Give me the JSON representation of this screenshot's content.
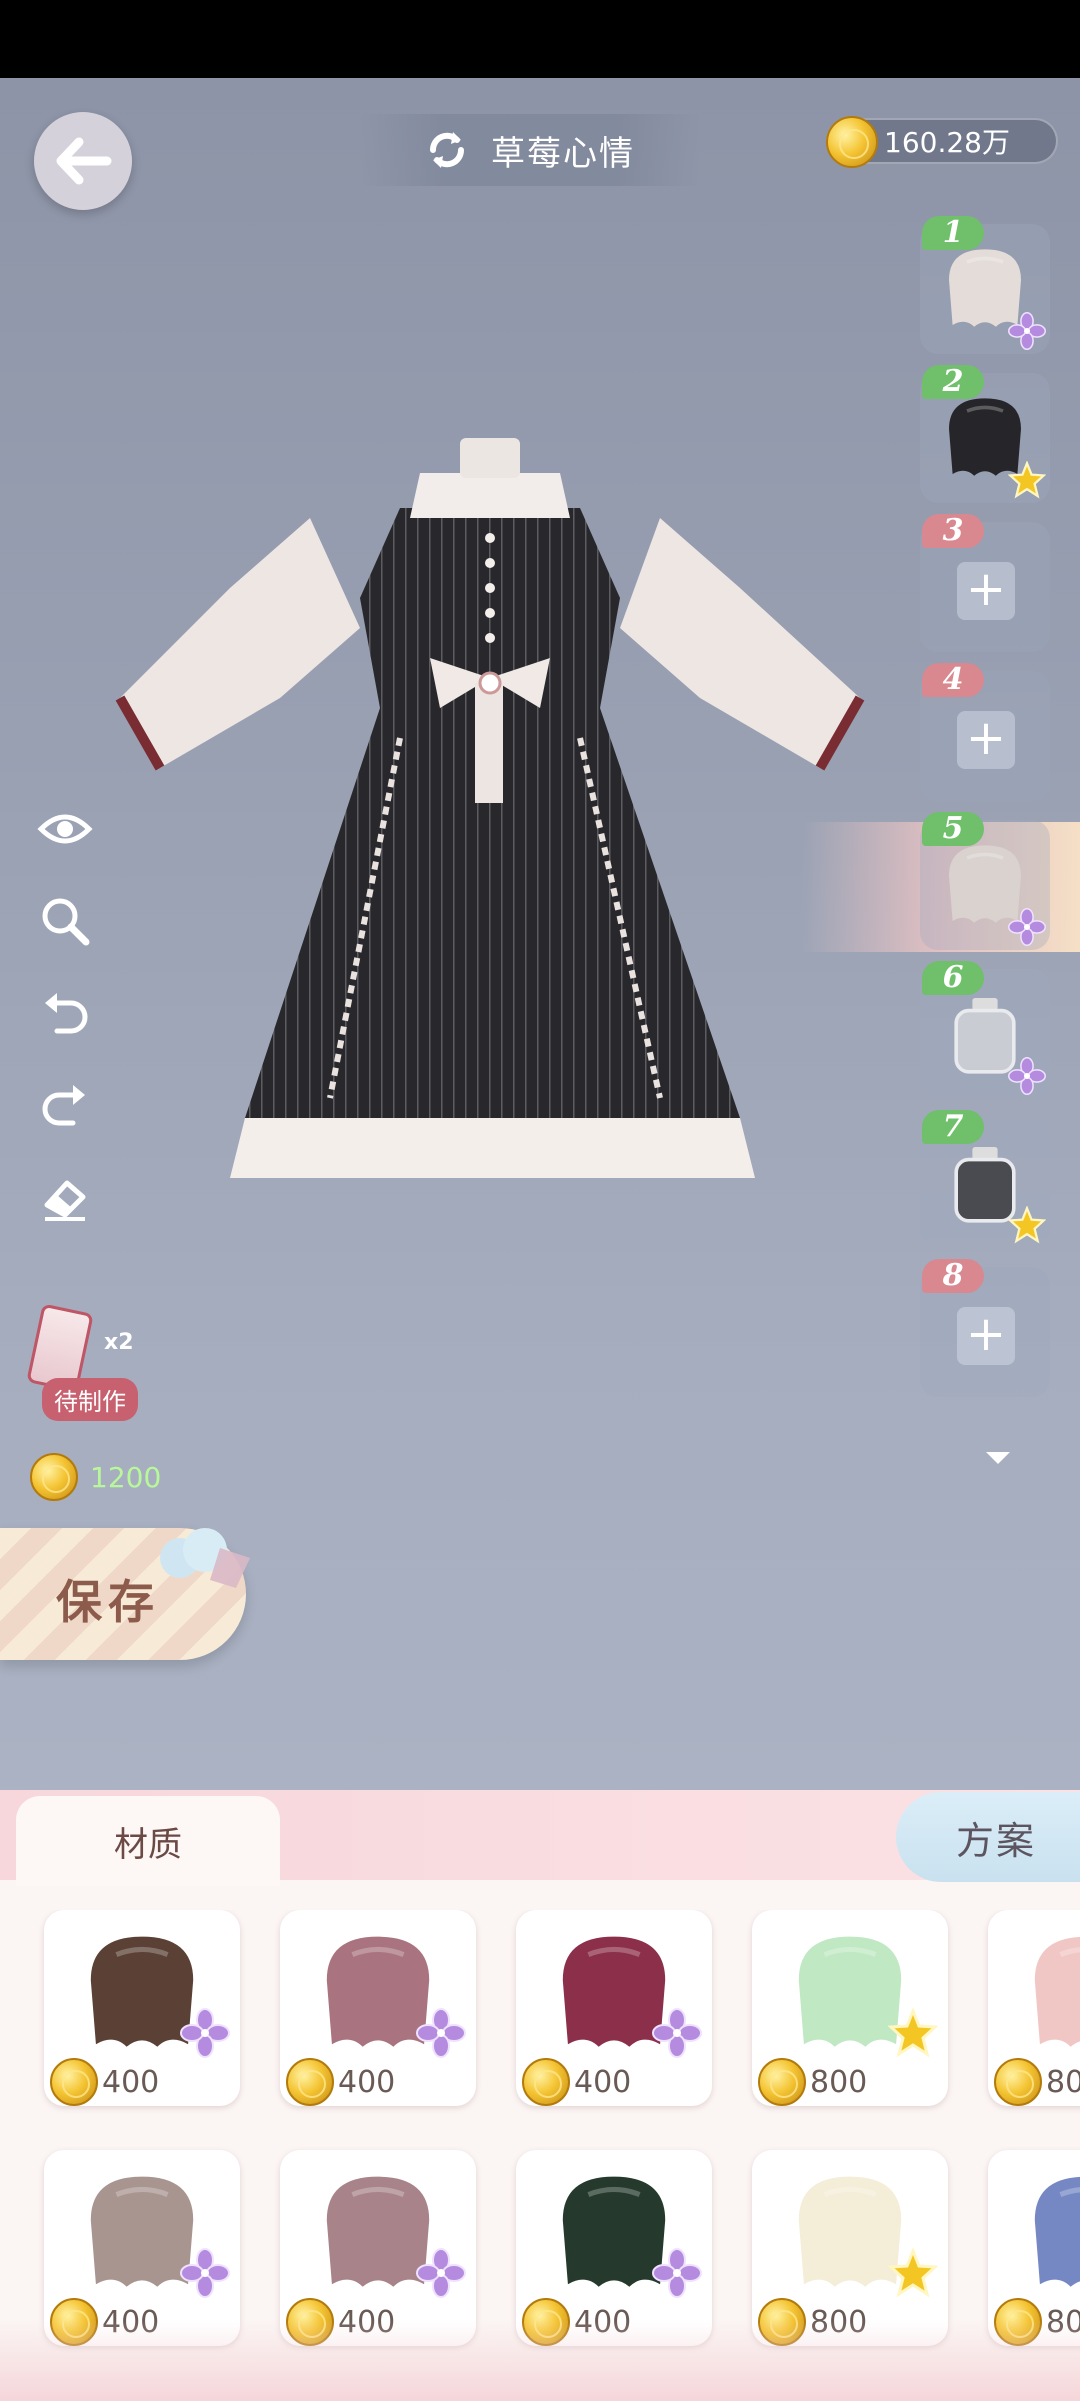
{
  "header": {
    "title": "草莓心情",
    "currency": "160.28万"
  },
  "tools": [
    "preview-icon",
    "zoom-icon",
    "undo-icon",
    "redo-icon",
    "eraser-icon"
  ],
  "pending": {
    "count": "x2",
    "label": "待制作"
  },
  "cost": "1200",
  "save_label": "保存",
  "slots": [
    {
      "num": "1",
      "filled": true,
      "color": "#e4dcd8",
      "rarity": "purple"
    },
    {
      "num": "2",
      "filled": true,
      "color": "#26262a",
      "rarity": "gold"
    },
    {
      "num": "3",
      "filled": false
    },
    {
      "num": "4",
      "filled": false
    },
    {
      "num": "5",
      "filled": true,
      "color": "#d9d2ce",
      "rarity": "purple",
      "selected": true
    },
    {
      "num": "6",
      "filled": true,
      "color": "#c9ccd2",
      "rarity": "purple",
      "bottle": true
    },
    {
      "num": "7",
      "filled": true,
      "color": "#4a4b50",
      "rarity": "gold",
      "bottle": true
    },
    {
      "num": "8",
      "filled": false
    }
  ],
  "tabs": {
    "material": "材质",
    "plan": "方案"
  },
  "materials": [
    {
      "color": "#5a4035",
      "rarity": "purple",
      "price": "400"
    },
    {
      "color": "#a9747f",
      "rarity": "purple",
      "price": "400"
    },
    {
      "color": "#8b2f4a",
      "rarity": "purple",
      "price": "400"
    },
    {
      "color": "#bfe8c3",
      "rarity": "gold",
      "price": "800"
    },
    {
      "color": "#f1c7c5",
      "rarity": "purple",
      "price": "80"
    },
    {
      "color": "#a89590",
      "rarity": "purple",
      "price": "400"
    },
    {
      "color": "#a8848a",
      "rarity": "purple",
      "price": "400"
    },
    {
      "color": "#253a2c",
      "rarity": "purple",
      "price": "400"
    },
    {
      "color": "#f4edd8",
      "rarity": "gold",
      "price": "800"
    },
    {
      "color": "#7688c4",
      "rarity": "purple",
      "price": "80"
    }
  ]
}
